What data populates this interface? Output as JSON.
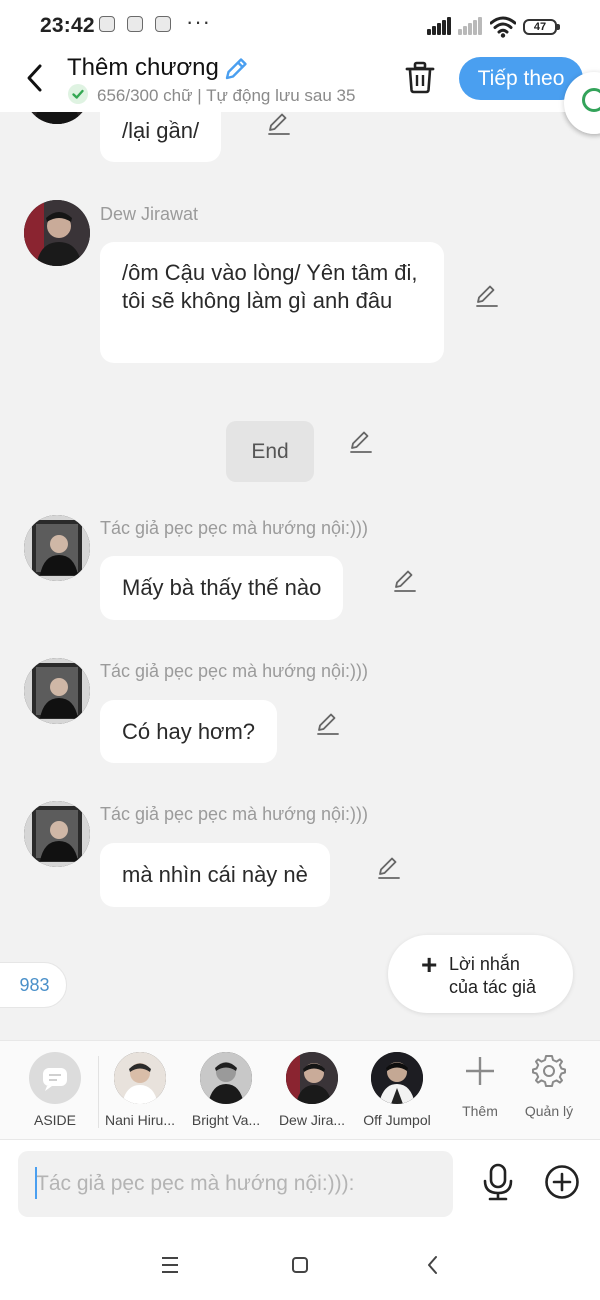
{
  "status_bar": {
    "time": "23:42",
    "battery": "47"
  },
  "header": {
    "title": "Thêm chương",
    "subtitle": "656/300 chữ | Tự động lưu sau 35",
    "next_label": "Tiếp theo"
  },
  "messages": [
    {
      "sender": "",
      "text": "/lại gần/"
    },
    {
      "sender": "Dew Jirawat",
      "text": "/ôm Cậu vào lòng/ Yên tâm đi, tôi sẽ không làm gì anh đâu"
    },
    {
      "type": "marker",
      "text": "End"
    },
    {
      "sender": "Tác giả pẹc pẹc mà hướng nội:)))",
      "text": "Mấy bà thấy thế nào"
    },
    {
      "sender": "Tác giả pẹc pẹc mà hướng nội:)))",
      "text": "Có hay hơm?"
    },
    {
      "sender": "Tác giả pẹc pẹc mà hướng nội:)))",
      "text": "mà nhìn cái này nè"
    }
  ],
  "count_badge": "983",
  "author_note": {
    "line1": "Lời nhắn",
    "line2": "của tác giả"
  },
  "characters": [
    {
      "label": "ASIDE",
      "icon": "chat-bubble-icon"
    },
    {
      "label": "Nani Hiru..."
    },
    {
      "label": "Bright Va..."
    },
    {
      "label": "Dew Jira..."
    },
    {
      "label": "Off Jumpol"
    }
  ],
  "actions": {
    "add_label": "Thêm",
    "manage_label": "Quản lý"
  },
  "composer": {
    "placeholder": "Tác giả pẹc pẹc mà hướng nội:))):"
  },
  "colors": {
    "accent": "#4a9ff0",
    "background": "#f2f2f2",
    "bubble": "#ffffff",
    "success": "#34a853"
  }
}
